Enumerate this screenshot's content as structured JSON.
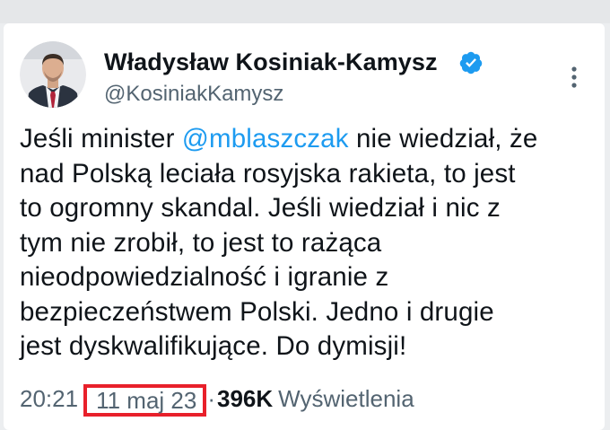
{
  "author": {
    "display_name": "Władysław Kosiniak-Kamysz",
    "handle": "@KosiniakKamysz",
    "verified_color": "#1d9bf0"
  },
  "tweet": {
    "line1_pre": "Jeśli minister ",
    "mention": "@mblaszczak",
    "line1_post": " nie wiedział, że",
    "line2": "nad Polską leciała rosyjska rakieta, to jest",
    "line3": "to ogromny skandal. Jeśli wiedział i nic z",
    "line4": "tym nie zrobił, to jest to rażąca",
    "line5": "nieodpowiedzialność i igranie z",
    "line6": "bezpieczeństwem Polski. Jedno i drugie",
    "line7": "jest dyskwalifikujące. Do dymisji!"
  },
  "meta": {
    "time": "20:21",
    "date": "11 maj 23",
    "separator": "·",
    "views_count": "396K",
    "views_label": "Wyświetlenia"
  },
  "colors": {
    "text": "#0f1419",
    "secondary": "#536471",
    "link": "#1d9bf0",
    "highlight_box": "#e8202a"
  }
}
